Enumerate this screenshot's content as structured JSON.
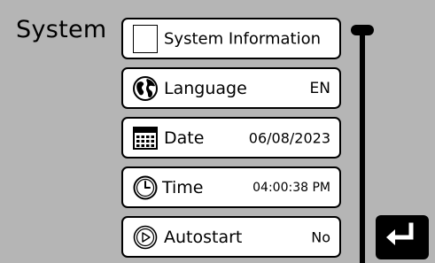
{
  "screen": {
    "title": "System"
  },
  "menu": {
    "items": [
      {
        "id": "system-information",
        "label": "System Information",
        "value": "",
        "icon": "blank-icon"
      },
      {
        "id": "language",
        "label": "Language",
        "value": "EN",
        "icon": "globe-icon"
      },
      {
        "id": "date",
        "label": "Date",
        "value": "06/08/2023",
        "icon": "calendar-icon"
      },
      {
        "id": "time",
        "label": "Time",
        "value": "04:00:38 PM",
        "icon": "clock-icon"
      },
      {
        "id": "autostart",
        "label": "Autostart",
        "value": "No",
        "icon": "play-circle-icon"
      }
    ]
  },
  "scrollbar": {
    "position": 0
  },
  "back_button": {
    "icon": "return-arrow-icon"
  },
  "colors": {
    "background": "#b5b5b5",
    "item_background": "#ffffff",
    "foreground": "#000000"
  }
}
